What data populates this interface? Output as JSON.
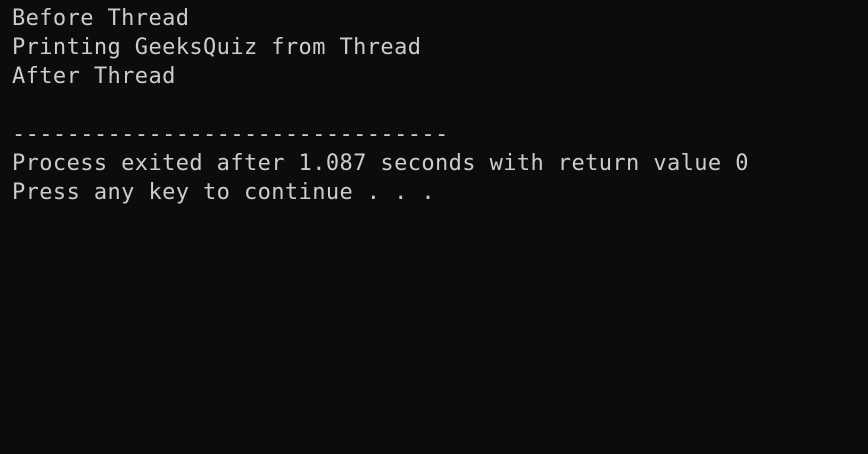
{
  "colors": {
    "background": "#0c0c0c",
    "text": "#cccccc"
  },
  "console": {
    "lines": [
      "Before Thread",
      "Printing GeeksQuiz from Thread",
      "After Thread",
      "",
      "--------------------------------",
      "Process exited after 1.087 seconds with return value 0",
      "Press any key to continue . . ."
    ]
  }
}
